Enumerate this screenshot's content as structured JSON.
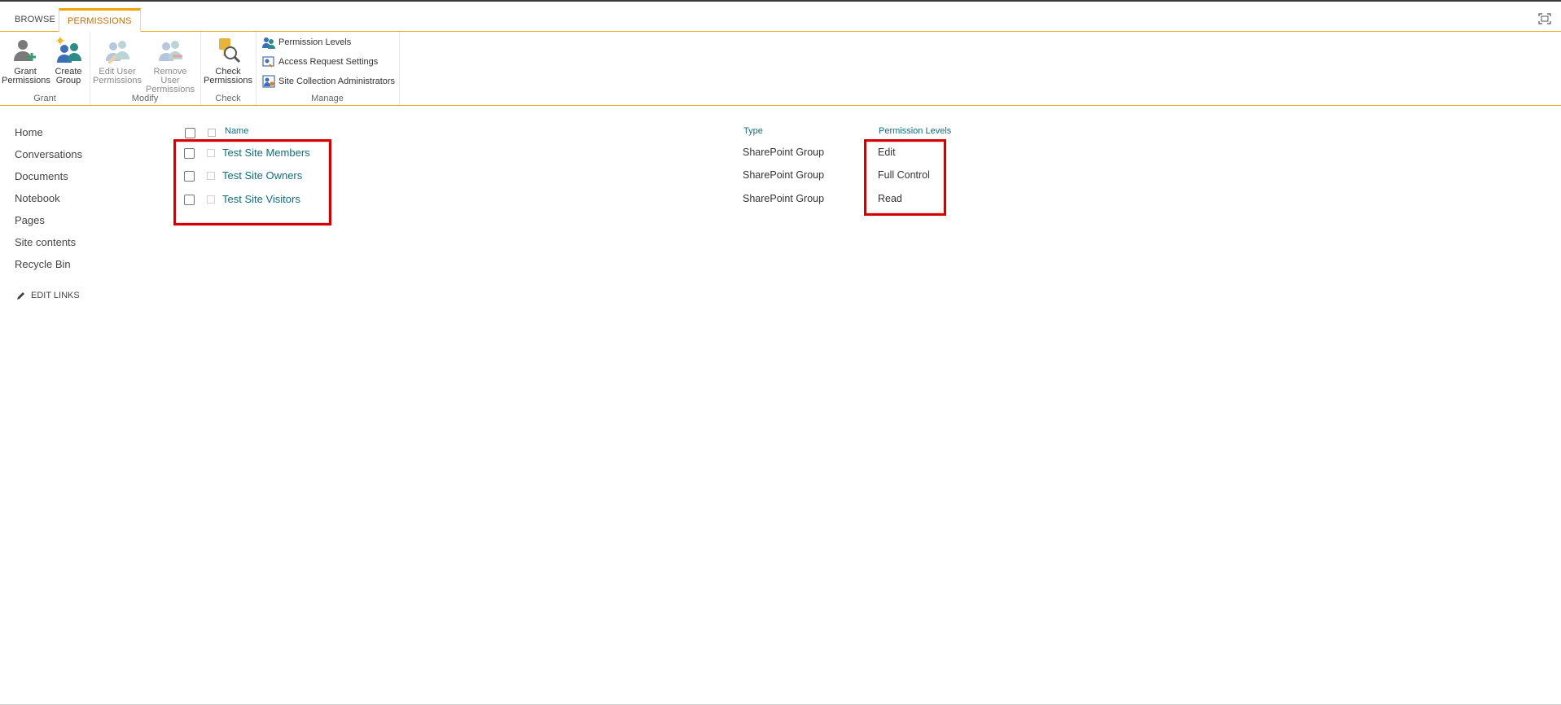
{
  "ribbon": {
    "tabs": [
      {
        "label": "BROWSE"
      },
      {
        "label": "PERMISSIONS"
      }
    ],
    "groups": {
      "grant": {
        "label": "Grant",
        "grant_permissions": {
          "line1": "Grant",
          "line2": "Permissions"
        },
        "create_group": {
          "line1": "Create",
          "line2": "Group"
        }
      },
      "modify": {
        "label": "Modify",
        "edit_user": {
          "line1": "Edit User",
          "line2": "Permissions"
        },
        "remove_user": {
          "line1": "Remove User",
          "line2": "Permissions"
        }
      },
      "check": {
        "label": "Check",
        "check_permissions": {
          "line1": "Check",
          "line2": "Permissions"
        }
      },
      "manage": {
        "label": "Manage",
        "items": [
          "Permission Levels",
          "Access Request Settings",
          "Site Collection Administrators"
        ]
      }
    }
  },
  "nav": {
    "items": [
      "Home",
      "Conversations",
      "Documents",
      "Notebook",
      "Pages",
      "Site contents",
      "Recycle Bin"
    ],
    "edit_links": "EDIT LINKS"
  },
  "table": {
    "columns": {
      "name": "Name",
      "type": "Type",
      "permission_levels": "Permission Levels"
    },
    "rows": [
      {
        "name": "Test Site Members",
        "type": "SharePoint Group",
        "permission": "Edit"
      },
      {
        "name": "Test Site Owners",
        "type": "SharePoint Group",
        "permission": "Full Control"
      },
      {
        "name": "Test Site Visitors",
        "type": "SharePoint Group",
        "permission": "Read"
      }
    ]
  },
  "colors": {
    "accent": "#f0a30a",
    "link": "#0f6e7d",
    "highlight": "#d40000"
  },
  "icons": {
    "focus": "focus-content-icon",
    "pencil": "pencil-icon"
  }
}
